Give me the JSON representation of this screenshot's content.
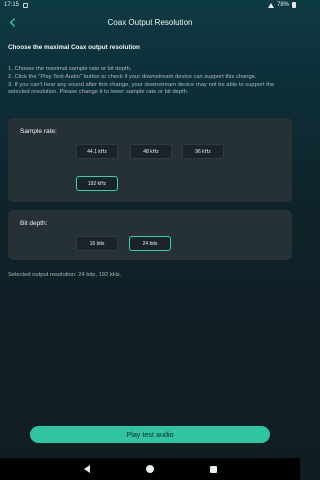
{
  "status_bar": {
    "time": "17:15",
    "battery": "78%"
  },
  "header": {
    "title": "Coax Output Resolution"
  },
  "main": {
    "heading": "Choose the maximal Coax output resolution",
    "instructions": [
      "1. Choose the maximal sample rate or bit depth.",
      "2. Click the \"Play Test Audio\" button to check if your downstream device can support this change.",
      "3. If you can't hear any sound after this change, your downstream device may not be able to support the selected resolution. Please change it to lower sample rate or bit depth."
    ],
    "sample_rate": {
      "label": "Sample rate:",
      "options": [
        "44.1 kHz",
        "48 kHz",
        "96 kHz",
        "192 kHz"
      ],
      "selected": "192 kHz"
    },
    "bit_depth": {
      "label": "Bit depth:",
      "options": [
        "16 bits",
        "24 bits"
      ],
      "selected": "24 bits"
    },
    "summary": "Selected output resolution: 24 bits, 192 kHz."
  },
  "footer": {
    "play_button": "Play test audio"
  },
  "colors": {
    "accent": "#2fc4a2",
    "selected_border": "#2fd3b0",
    "card": "#253135"
  },
  "icons": [
    "back-arrow-icon",
    "wifi-icon",
    "battery-icon",
    "nav-back-icon",
    "nav-home-icon",
    "nav-recent-icon"
  ]
}
